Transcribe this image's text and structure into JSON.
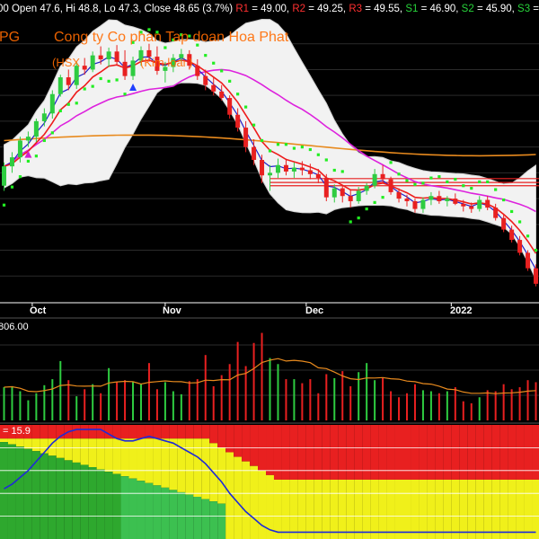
{
  "header": {
    "segments": [
      {
        "text": "00 Open 47.6, Hi 48.8, Lo 47.3, Close 48.65 (3.7%)",
        "color": "#ffffff"
      },
      {
        "text": " R1",
        "color": "#ff3030"
      },
      {
        "text": " = 49.00,",
        "color": "#ffffff"
      },
      {
        "text": " R2",
        "color": "#ff3030"
      },
      {
        "text": " = 49.25,",
        "color": "#ffffff"
      },
      {
        "text": " R3",
        "color": "#ff3030"
      },
      {
        "text": " = 49.55,",
        "color": "#ffffff"
      },
      {
        "text": " S1",
        "color": "#27d33a"
      },
      {
        "text": " = 46.90,",
        "color": "#ffffff"
      },
      {
        "text": " S2",
        "color": "#27d33a"
      },
      {
        "text": " = 45.90,",
        "color": "#ffffff"
      },
      {
        "text": " S3",
        "color": "#27d33a"
      },
      {
        "text": " =",
        "color": "#ffffff"
      }
    ]
  },
  "overlay": {
    "ticker": "PG",
    "company": "Cong ty Co phan Tap doan Hoa Phat",
    "exchange": "(HSX",
    "sector": "(Kim loai )"
  },
  "x_axis": {
    "labels": [
      "Oct",
      "Nov",
      "Dec",
      "2022"
    ]
  },
  "volume": {
    "label": "806.00"
  },
  "indicator": {
    "label": "= 15.9"
  },
  "colors": {
    "up": "#2ecc40",
    "down": "#e82020",
    "band": "#f2f2f2",
    "ema_fast": "#ee1c1c",
    "ema_slow": "#2020c8",
    "ma_mid": "#dd22dd",
    "ma_long": "#e88a1e",
    "sar": "#22ee22",
    "accent_text": "#ff6a00"
  },
  "chart_data": [
    {
      "type": "candlestick",
      "title": "PG",
      "categories": [
        "Oct",
        "Nov",
        "Dec",
        "2022"
      ],
      "series": [
        {
          "values": [
            [
              49.0,
              50.8,
              48.6,
              50.5
            ],
            [
              50.5,
              51.6,
              50.0,
              51.2
            ],
            [
              51.2,
              52.8,
              50.8,
              52.5
            ],
            [
              52.5,
              53.2,
              52.0,
              52.8
            ],
            [
              52.8,
              54.2,
              52.4,
              54.0
            ],
            [
              54.0,
              55.0,
              53.6,
              54.6
            ],
            [
              54.6,
              56.4,
              54.2,
              56.1
            ],
            [
              56.1,
              57.6,
              55.9,
              57.4
            ],
            [
              57.4,
              58.0,
              56.4,
              56.8
            ],
            [
              56.8,
              58.6,
              56.5,
              58.3
            ],
            [
              58.3,
              58.9,
              57.6,
              58.0
            ],
            [
              58.0,
              59.4,
              57.8,
              59.1
            ],
            [
              59.1,
              59.8,
              58.4,
              58.8
            ],
            [
              58.8,
              59.7,
              58.2,
              59.4
            ],
            [
              59.4,
              59.9,
              58.3,
              58.6
            ],
            [
              58.6,
              59.5,
              57.2,
              57.5
            ],
            [
              57.5,
              59.0,
              57.2,
              58.7
            ],
            [
              58.7,
              59.8,
              58.3,
              59.5
            ],
            [
              59.5,
              60.0,
              58.6,
              59.0
            ],
            [
              59.0,
              59.8,
              57.6,
              57.9
            ],
            [
              57.9,
              58.6,
              57.0,
              58.2
            ],
            [
              58.2,
              59.2,
              57.8,
              58.9
            ],
            [
              58.9,
              59.6,
              58.6,
              59.2
            ],
            [
              59.2,
              59.5,
              58.0,
              58.3
            ],
            [
              58.3,
              58.8,
              57.2,
              57.5
            ],
            [
              57.5,
              58.0,
              56.4,
              56.8
            ],
            [
              56.8,
              57.4,
              56.0,
              56.3
            ],
            [
              56.3,
              56.8,
              55.6,
              55.8
            ],
            [
              55.8,
              56.0,
              54.2,
              54.5
            ],
            [
              54.5,
              55.0,
              53.2,
              53.5
            ],
            [
              53.5,
              54.0,
              51.6,
              52.0
            ],
            [
              52.0,
              52.6,
              50.6,
              51.0
            ],
            [
              51.0,
              51.4,
              49.2,
              49.8
            ],
            [
              49.8,
              50.6,
              48.6,
              50.0
            ],
            [
              50.0,
              51.1,
              49.6,
              50.6
            ],
            [
              50.6,
              51.1,
              49.8,
              50.1
            ],
            [
              50.1,
              50.8,
              49.6,
              50.4
            ],
            [
              50.4,
              50.9,
              49.8,
              50.2
            ],
            [
              50.2,
              50.7,
              49.5,
              49.9
            ],
            [
              49.9,
              50.3,
              49.2,
              49.6
            ],
            [
              49.6,
              49.9,
              47.8,
              48.1
            ],
            [
              48.1,
              49.1,
              47.7,
              48.8
            ],
            [
              48.8,
              49.0,
              47.7,
              48.2
            ],
            [
              48.2,
              48.7,
              47.3,
              47.8
            ],
            [
              47.8,
              48.9,
              47.6,
              48.6
            ],
            [
              48.6,
              49.2,
              48.3,
              49.0
            ],
            [
              49.0,
              50.3,
              48.8,
              49.9
            ],
            [
              49.9,
              50.6,
              49.2,
              49.5
            ],
            [
              49.5,
              49.7,
              48.3,
              48.5
            ],
            [
              48.5,
              48.8,
              47.7,
              48.0
            ],
            [
              48.0,
              48.3,
              47.4,
              47.8
            ],
            [
              47.8,
              48.0,
              46.9,
              47.2
            ],
            [
              47.2,
              48.1,
              46.9,
              47.9
            ],
            [
              47.9,
              48.5,
              47.5,
              48.2
            ],
            [
              48.2,
              48.6,
              47.6,
              47.8
            ],
            [
              47.8,
              48.2,
              47.4,
              48.0
            ],
            [
              48.0,
              48.4,
              47.5,
              47.6
            ],
            [
              47.6,
              47.9,
              47.0,
              47.4
            ],
            [
              47.4,
              47.7,
              46.9,
              47.2
            ],
            [
              47.2,
              48.2,
              47.0,
              47.9
            ],
            [
              47.9,
              48.2,
              47.1,
              47.3
            ],
            [
              47.3,
              47.6,
              46.3,
              46.5
            ],
            [
              46.5,
              46.8,
              45.4,
              45.6
            ],
            [
              45.6,
              45.9,
              44.6,
              44.8
            ],
            [
              44.8,
              45.1,
              43.6,
              43.8
            ],
            [
              43.8,
              44.0,
              42.4,
              42.6
            ],
            [
              42.6,
              42.9,
              41.2,
              41.4
            ]
          ]
        }
      ]
    },
    {
      "type": "bar",
      "title": "Volume",
      "series": [
        {
          "values": [
            0.33,
            0.34,
            0.29,
            0.2,
            0.27,
            0.35,
            0.41,
            0.59,
            0.4,
            0.24,
            0.31,
            0.36,
            0.27,
            0.52,
            0.38,
            0.4,
            0.38,
            0.36,
            0.57,
            0.31,
            0.38,
            0.29,
            0.26,
            0.39,
            0.41,
            0.65,
            0.34,
            0.45,
            0.56,
            0.78,
            0.54,
            0.77,
            0.87,
            0.62,
            0.56,
            0.41,
            0.41,
            0.37,
            0.41,
            0.27,
            0.46,
            0.42,
            0.49,
            0.34,
            0.48,
            0.57,
            0.4,
            0.42,
            0.29,
            0.23,
            0.27,
            0.36,
            0.3,
            0.29,
            0.27,
            0.29,
            0.33,
            0.19,
            0.17,
            0.23,
            0.3,
            0.29,
            0.36,
            0.31,
            0.33,
            0.4,
            0.38
          ]
        }
      ]
    },
    {
      "type": "area",
      "title": "Indicator",
      "indicator_value": 15.9,
      "series": [
        {
          "values": [
            22,
            24,
            27,
            30,
            34,
            38,
            42,
            45,
            47,
            48,
            48,
            48,
            48,
            46,
            44,
            43,
            43,
            44,
            45,
            44,
            43,
            42,
            40,
            38,
            36,
            33,
            29,
            25,
            20,
            16,
            12,
            9,
            6,
            4,
            3,
            3,
            3,
            3,
            3,
            3,
            3,
            3,
            3,
            3,
            3,
            3,
            3,
            3,
            3,
            3,
            3,
            3,
            3,
            3,
            3,
            3,
            3,
            3,
            3,
            3,
            3,
            3,
            3,
            3,
            3,
            3,
            3
          ]
        }
      ]
    }
  ]
}
